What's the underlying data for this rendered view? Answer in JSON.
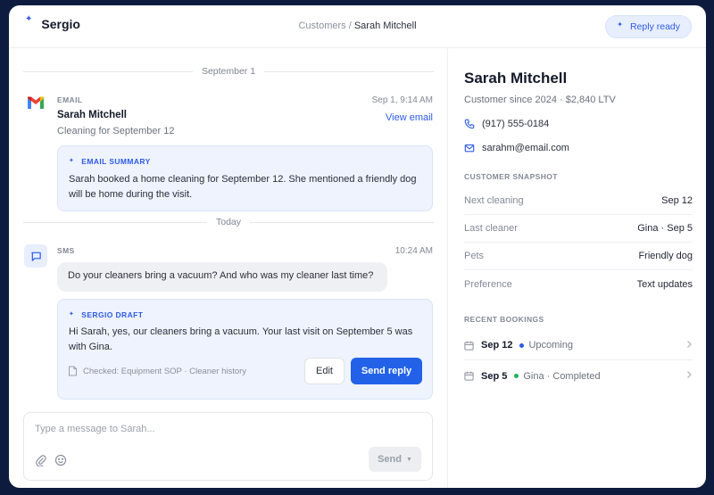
{
  "header": {
    "brand": "Sergio",
    "breadcrumb_parent": "Customers",
    "breadcrumb_sep": " / ",
    "breadcrumb_current": "Sarah Mitchell",
    "status_pill": "Reply ready"
  },
  "timeline": {
    "divider_1": "September 1",
    "email": {
      "channel": "EMAIL",
      "sender": "Sarah Mitchell",
      "subject": "Cleaning for September 12",
      "time": "Sep 1, 9:14 AM",
      "link": "View email"
    },
    "email_summary": {
      "title": "EMAIL SUMMARY",
      "body": "Sarah booked a home cleaning for September 12. She mentioned a friendly dog will be home during the visit."
    },
    "divider_2": "Today",
    "sms": {
      "channel": "SMS",
      "time": "10:24 AM",
      "message": "Do your cleaners bring a vacuum? And who was my cleaner last time?"
    },
    "draft": {
      "title": "SERGIO DRAFT",
      "body": "Hi Sarah, yes, our cleaners bring a vacuum. Your last visit on September 5 was with Gina.",
      "checked": "Checked: Equipment SOP · Cleaner history",
      "edit_label": "Edit",
      "send_label": "Send reply"
    }
  },
  "composer": {
    "placeholder": "Type a message to Sarah...",
    "send_label": "Send"
  },
  "profile": {
    "name": "Sarah Mitchell",
    "since": "Customer since 2024 · $2,840 LTV",
    "phone": "(917) 555-0184",
    "email": "sarahm@email.com",
    "snapshot_title": "CUSTOMER SNAPSHOT",
    "snapshot": [
      {
        "key": "Next cleaning",
        "value": "Sep 12"
      },
      {
        "key": "Last cleaner",
        "value": "Gina · Sep 5"
      },
      {
        "key": "Pets",
        "value": "Friendly dog"
      },
      {
        "key": "Preference",
        "value": "Text updates"
      }
    ],
    "bookings_title": "RECENT BOOKINGS",
    "bookings": [
      {
        "date": "Sep 12",
        "status": "Upcoming",
        "dot_color": "#2f5be8"
      },
      {
        "date": "Sep 5",
        "status": "Gina · Completed",
        "dot_color": "#22b35a"
      }
    ]
  },
  "colors": {
    "accent": "#2f5be8",
    "primary_button": "#2362e8",
    "background": "#0d1b3e",
    "upcoming": "#2f5be8",
    "completed": "#22b35a"
  }
}
